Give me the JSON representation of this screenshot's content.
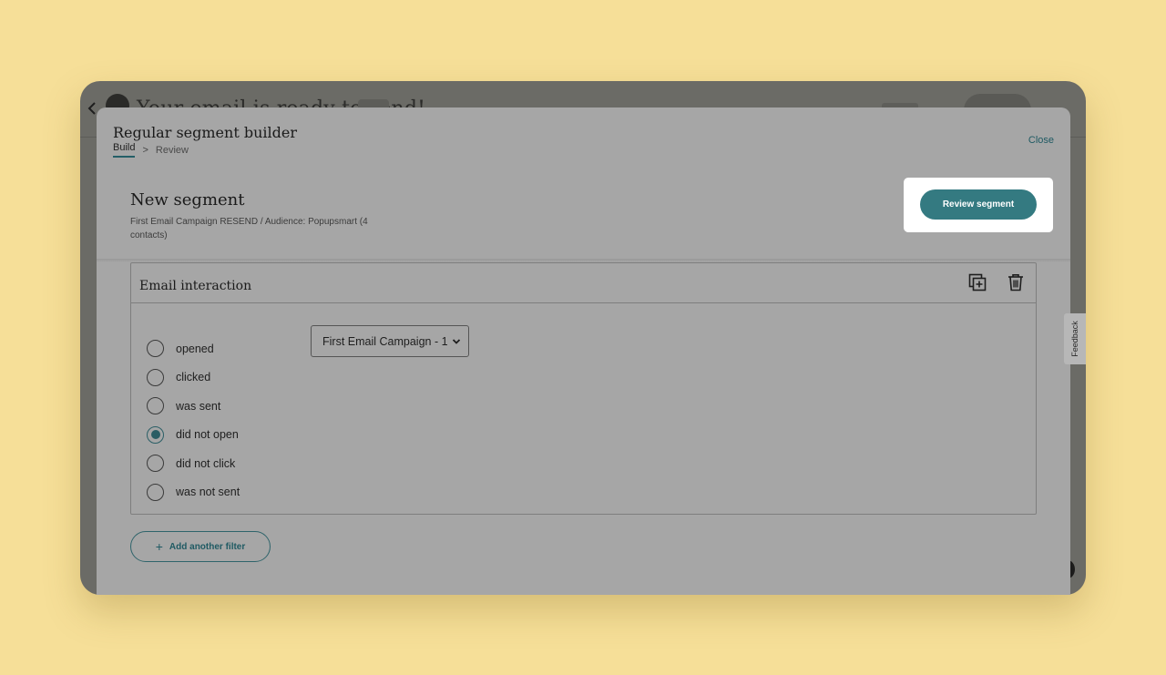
{
  "background_app": {
    "title": "Your email is ready to send!"
  },
  "modal": {
    "title": "Regular segment builder",
    "breadcrumb": {
      "build": "Build",
      "separator": ">",
      "review": "Review"
    },
    "close_label": "Close"
  },
  "segment": {
    "title": "New segment",
    "subtitle": "First Email Campaign RESEND / Audience: Popupsmart (4 contacts)",
    "review_button": "Review segment"
  },
  "filter": {
    "title": "Email interaction",
    "options": [
      {
        "label": "opened",
        "checked": false
      },
      {
        "label": "clicked",
        "checked": false
      },
      {
        "label": "was sent",
        "checked": false
      },
      {
        "label": "did not open",
        "checked": true
      },
      {
        "label": "did not click",
        "checked": false
      },
      {
        "label": "was not sent",
        "checked": false
      }
    ],
    "campaign_select": "First Email Campaign - 1"
  },
  "add_filter": {
    "icon": "+",
    "label": "Add another filter"
  },
  "feedback_tab": "Feedback",
  "colors": {
    "page_bg": "#f6df98",
    "accent": "#347a81",
    "overlay": "#a6a6a6"
  }
}
